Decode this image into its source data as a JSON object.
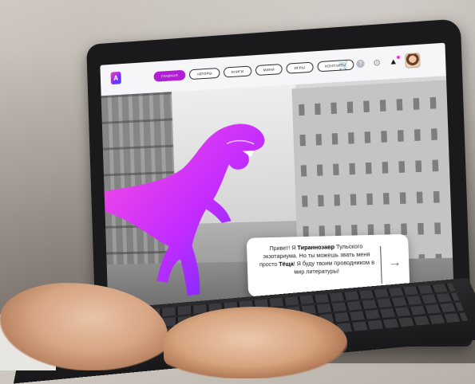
{
  "nav": {
    "logo_glyph": "A",
    "pills": [
      "ГЛАВНАЯ",
      "АВТОРЫ",
      "КНИГИ",
      "МИНИ",
      "ИГРЫ",
      "КОНТАКТЫ"
    ],
    "active_index": 0,
    "icons": [
      "cart-icon",
      "help-icon",
      "gear-icon",
      "bell-icon",
      "avatar"
    ]
  },
  "hero": {
    "greeting_start": "Привет! Я ",
    "greeting_bold_1": "Тираннозавр",
    "greeting_mid_1": " Тульского экзотариума. Но ты можешь звать меня просто ",
    "greeting_bold_2": "Тёща",
    "greeting_end": "! Я буду твоим проводником в мир литературы!",
    "next_arrow": "→"
  },
  "colors": {
    "accent": "#b21ed6",
    "dino_pink": "#ff3fd8",
    "dino_violet": "#7b2cff"
  }
}
